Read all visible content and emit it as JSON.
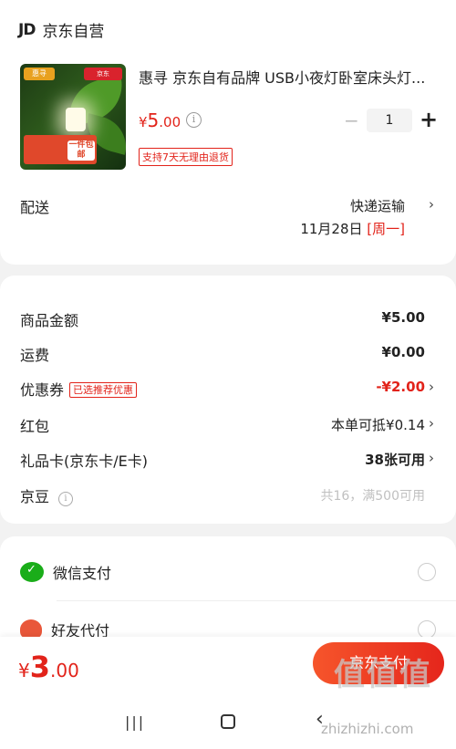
{
  "store": {
    "logo": "JD",
    "name": "京东自营"
  },
  "product": {
    "image_brand_badge": "惠寻",
    "image_jd_badge": "京东",
    "image_promo_tag": "一件包邮",
    "title": "惠寻 京东自有品牌 USB小夜灯卧室床头灯...",
    "price_symbol": "¥",
    "price_int": "5",
    "price_dec": ".00",
    "info_icon": "i",
    "qty_minus": "−",
    "quantity": "1",
    "qty_plus": "+",
    "return_tag": "支持7天无理由退货"
  },
  "delivery": {
    "label": "配送",
    "method": "快递运输",
    "date": "11月28日",
    "weekday": "[周一]"
  },
  "summary": {
    "goods_label": "商品金额",
    "goods_value": "¥5.00",
    "shipping_label": "运费",
    "shipping_value": "¥0.00",
    "coupon_label": "优惠券",
    "coupon_badge": "已选推荐优惠",
    "coupon_value": "-¥2.00",
    "redpacket_label": "红包",
    "redpacket_value": "本单可抵¥0.14",
    "giftcard_label": "礼品卡(京东卡/E卡)",
    "giftcard_value": "38张可用",
    "jingdou_label": "京豆",
    "jingdou_info": "i",
    "jingdou_value": "共16，满500可用"
  },
  "payment": {
    "wechat_label": "微信支付",
    "friend_label": "好友代付"
  },
  "footer": {
    "total_symbol": "¥",
    "total_int": "3",
    "total_dec": ".00",
    "pay_button": "京东支付"
  },
  "navbar": {
    "recents": "|||",
    "back": "‹"
  },
  "watermark": {
    "logo": "值值值",
    "url": "zhizhizhi.com"
  },
  "colors": {
    "accent": "#e2231a",
    "wechat": "#1aad19"
  },
  "icons": [
    "info-icon",
    "chevron-right-icon",
    "wechat-pay-icon",
    "friend-pay-icon",
    "radio-icon",
    "home-icon",
    "recents-icon",
    "back-icon"
  ]
}
